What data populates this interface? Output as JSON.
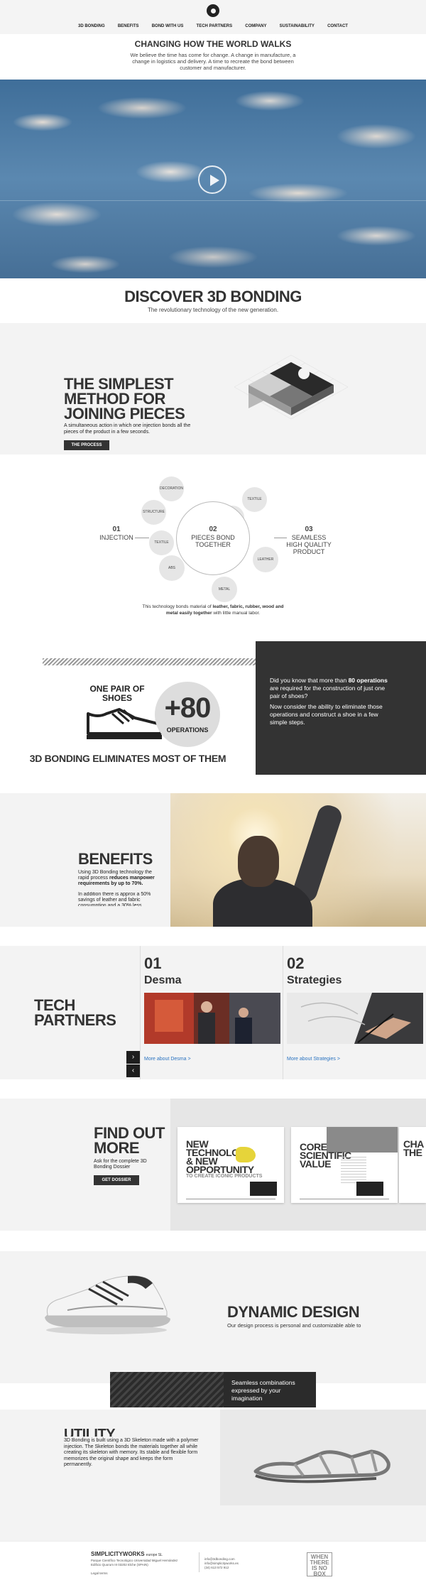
{
  "nav": [
    "3D BONDING",
    "BENEFITS",
    "BOND WITH US",
    "TECH PARTNERS",
    "COMPANY",
    "SUSTAINABILITY",
    "CONTACT"
  ],
  "intro": {
    "title": "CHANGING HOW THE WORLD WALKS",
    "text": "We believe the time has come for change. A change in manufacture, a change in logistics and delivery. A time to recreate the bond between customer and manufacturer."
  },
  "discover": {
    "title": "DISCOVER 3D BONDING",
    "subtitle": "The revolutionary technology of the new generation."
  },
  "simplest": {
    "title": "THE SIMPLEST METHOD FOR JOINING PIECES",
    "text": "A simultaneous action in which one injection bonds all the pieces of the product in a few seconds.",
    "button": "THE PROCESS"
  },
  "pieces": {
    "center_num": "02",
    "center_label": "PIECES BOND TOGETHER",
    "step1_num": "01",
    "step1_label": "INJECTION",
    "step3_num": "03",
    "step3_label": "SEAMLESS HIGH QUALITY PRODUCT",
    "materials": [
      "DECORATION",
      "STRUCTURE",
      "TEXTILE",
      "ABS",
      "METAL",
      "LEATHER",
      "PLASTIC",
      "TEXTILE"
    ],
    "caption_pre": "This technology bonds material of ",
    "caption_bold1": "leather, fabric, rubber, wood and metal easily together",
    "caption_post": " with little manual labor."
  },
  "operations": {
    "one_pair": "ONE PAIR OF SHOES",
    "number": "+80",
    "label": "OPERATIONS",
    "headline": "3D BONDING ELIMINATES MOST OF THEM",
    "p1_pre": "Did you know that more than ",
    "p1_bold": "80 operations",
    "p1_post": " are required for the construction of just one pair of shoes?",
    "p2": "Now consider the ability to eliminate those operations and construct a shoe in a few simple steps."
  },
  "benefits": {
    "title": "BENEFITS",
    "p1_pre": "Using 3D Bonding technology the rapid process ",
    "p1_bold": "reduces manpower requirements by up to 70%.",
    "p2": "In addition there is approx a 50% savings of leather and fabric consumption and a 30% less energy"
  },
  "tech": {
    "title": "TECH PARTNERS",
    "partners": [
      {
        "num": "01",
        "name": "Desma",
        "link": "More about Desma >"
      },
      {
        "num": "02",
        "name": "Strategies",
        "link": "More about Strategies >"
      }
    ],
    "next": "›",
    "prev": "‹"
  },
  "findout": {
    "title": "FIND OUT MORE",
    "text": "Ask for the complete 3D Bonding Dossier",
    "button": "GET DOSSIER",
    "cards": [
      {
        "title": "NEW TECHNOLOGY & NEW OPPORTUNITY",
        "sub": "TO CREATE ICONIC PRODUCTS"
      },
      {
        "title": "CORE SCIENTIFIC VALUE",
        "sub": ""
      },
      {
        "title": "CHA THE",
        "sub": ""
      }
    ]
  },
  "dynamic": {
    "title": "DYNAMIC DESIGN",
    "text": "Our design process is personal and customizable able to",
    "seamless": "Seamless combinations expressed by your imagination"
  },
  "utility": {
    "title": "UTILITY",
    "text": "3D Bonding is built using a 3D Skeleton made with a polymer injection. The Skeleton bonds the materials together all while creating its skeleton with memory. Its stable and flexible form memorizes the original shape and keeps the form permanently."
  },
  "footer": {
    "brand": "SIMPLICITYWORKS",
    "brand_sub": "europe SL",
    "address": "Parque Científico Tecnológico Universidad Miguel Hernández Edificio Quorum III 03202 Elche (SPAIN)",
    "legal": "Legal terms",
    "email": "info@3dbonding.com",
    "email2": "info@simplicityworks.es",
    "phone": "(34) 613 572 912",
    "stamp": "WHEN THERE IS NO BOX"
  },
  "colors": {
    "dark": "#333333",
    "light_bg": "#f3f3f3",
    "link": "#2a73c0"
  }
}
